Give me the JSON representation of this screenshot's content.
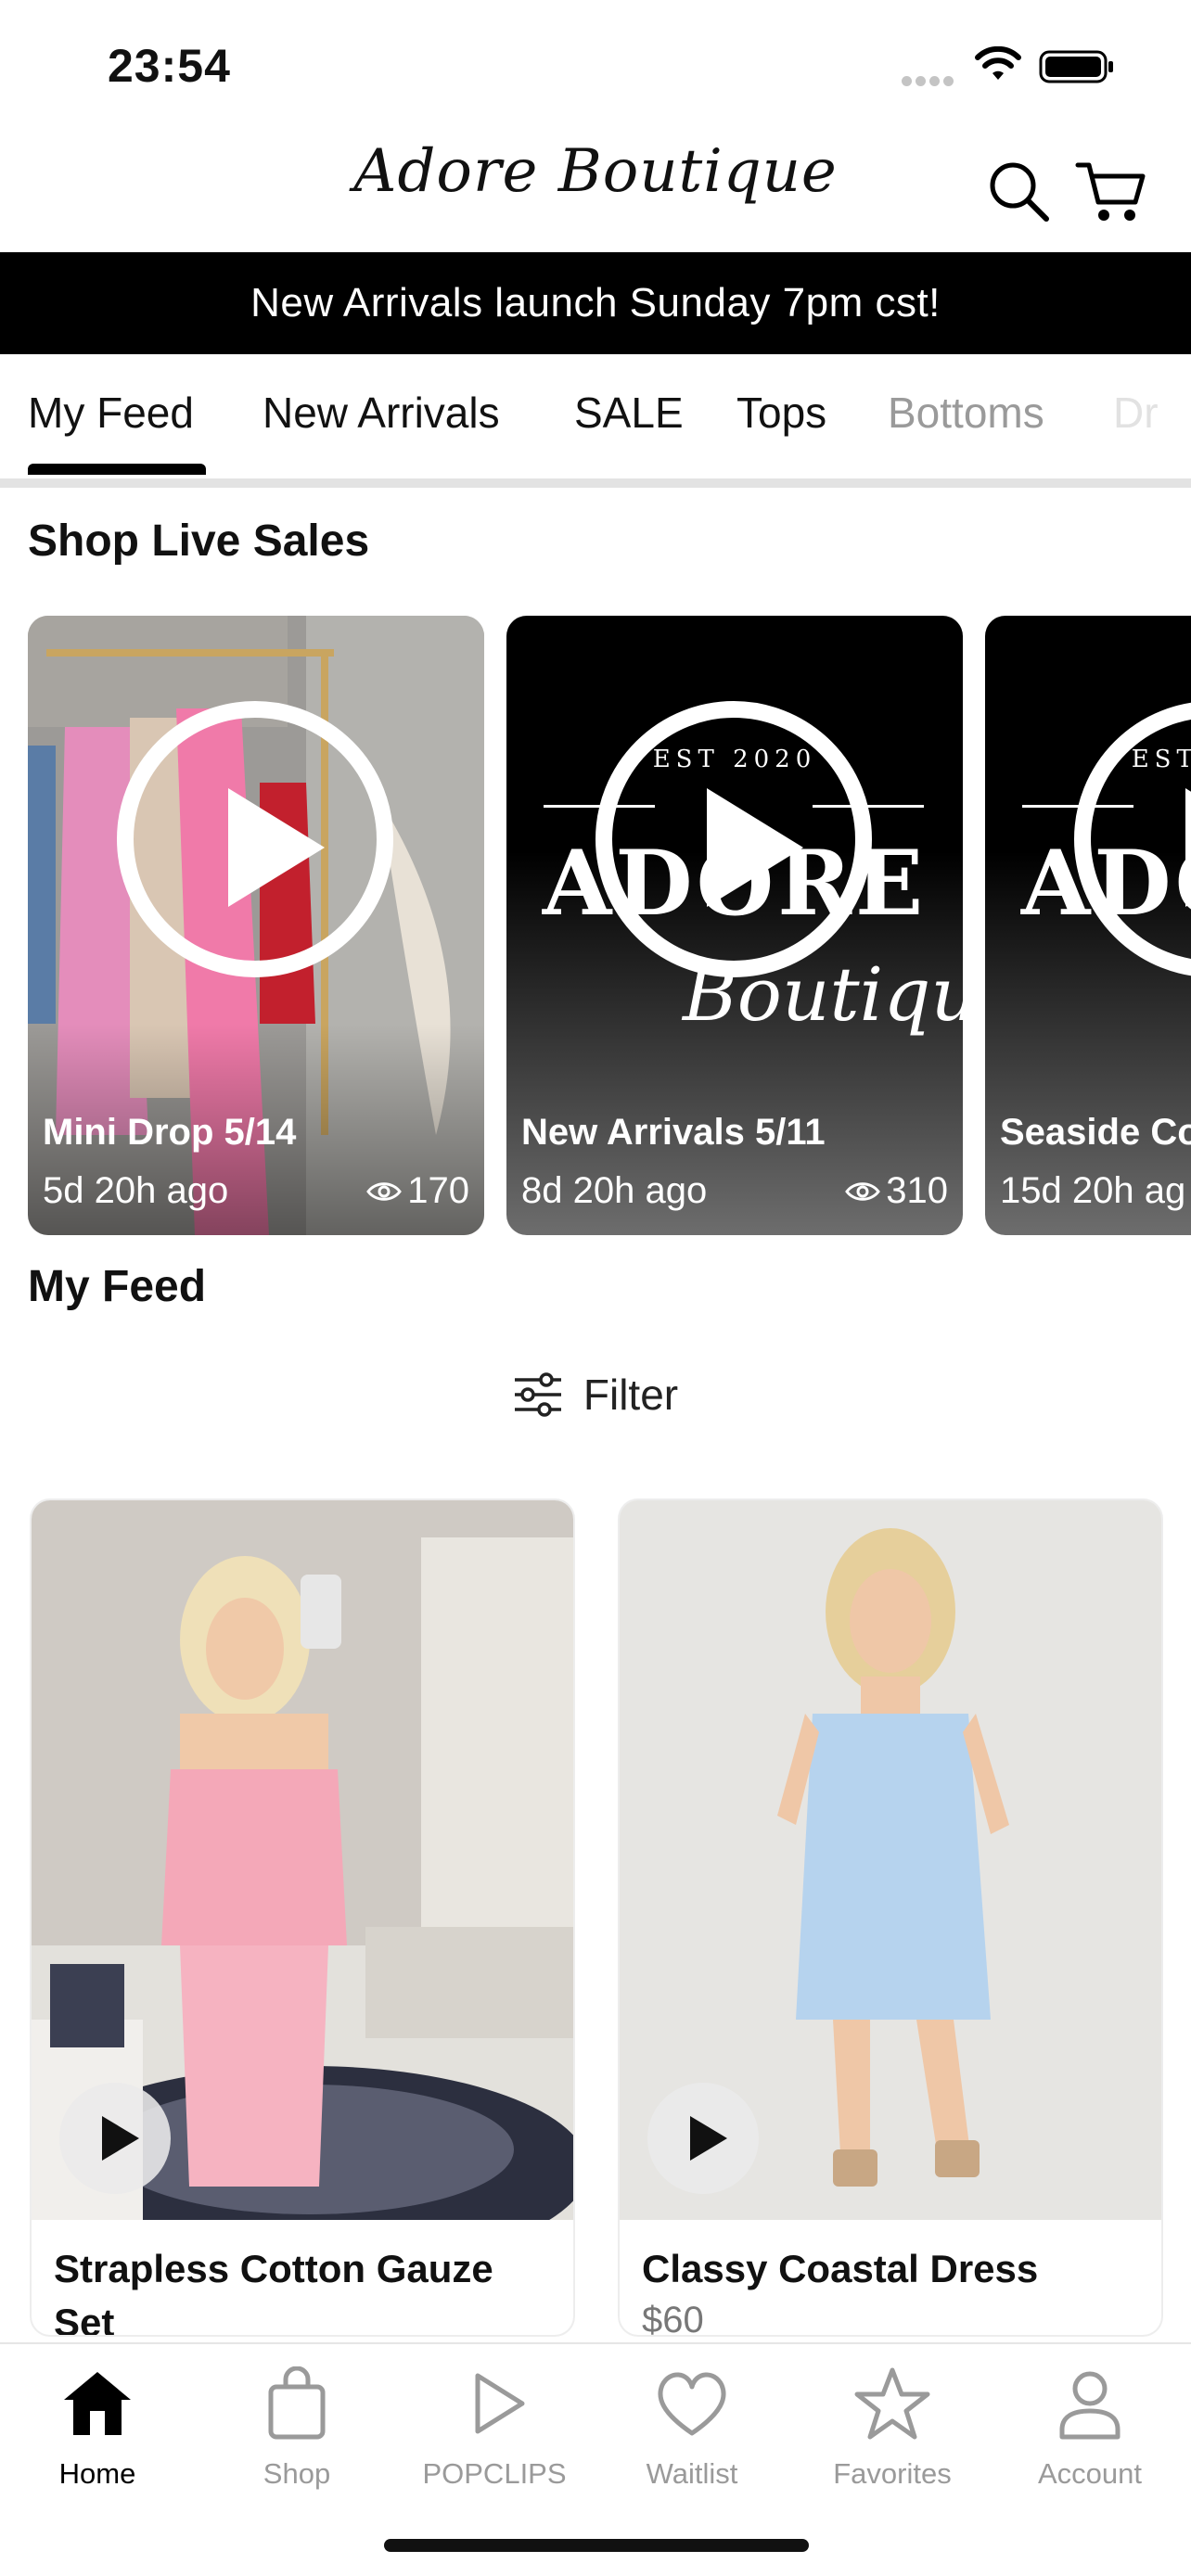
{
  "status_bar": {
    "time": "23:54"
  },
  "header": {
    "brand": "Adore Boutique"
  },
  "announcement": "New Arrivals launch Sunday 7pm cst!",
  "tabs": [
    "My Feed",
    "New Arrivals",
    "SALE",
    "Tops",
    "Bottoms",
    "Dr"
  ],
  "live_section": {
    "title": "Shop Live Sales",
    "cards": [
      {
        "title": "Mini Drop 5/14",
        "age": "5d 20h ago",
        "views": "170"
      },
      {
        "title": "New Arrivals 5/11",
        "age": "8d 20h ago",
        "views": "310"
      },
      {
        "title": "Seaside Co",
        "age": "15d 20h ag",
        "views": ""
      }
    ],
    "watermark": {
      "est": "EST 2020",
      "word": "ADORE",
      "script": "Boutique"
    }
  },
  "feed": {
    "title": "My Feed",
    "filter_label": "Filter",
    "products": [
      {
        "name": "Strapless Cotton Gauze Set",
        "price": ""
      },
      {
        "name": "Classy Coastal Dress",
        "price": "$60"
      }
    ]
  },
  "bottom_nav": [
    {
      "label": "Home",
      "icon": "home-icon",
      "active": true
    },
    {
      "label": "Shop",
      "icon": "shopping-bag-icon",
      "active": false
    },
    {
      "label": "POPCLIPS",
      "icon": "play-icon",
      "active": false
    },
    {
      "label": "Waitlist",
      "icon": "heart-icon",
      "active": false
    },
    {
      "label": "Favorites",
      "icon": "star-icon",
      "active": false
    },
    {
      "label": "Account",
      "icon": "person-icon",
      "active": false
    }
  ],
  "colors": {
    "accent": "#000000",
    "inactive": "#9a9a9a",
    "divider": "#e3e3e3"
  }
}
